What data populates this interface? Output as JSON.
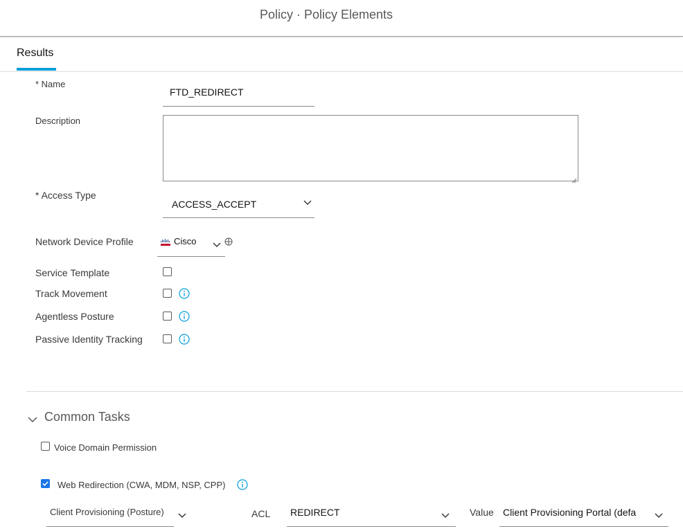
{
  "header": {
    "title": "Policy · Policy Elements"
  },
  "tabs": [
    {
      "label": "Results",
      "active": true
    }
  ],
  "form": {
    "name": {
      "label": "* Name",
      "value": "FTD_REDIRECT"
    },
    "description": {
      "label": "Description",
      "value": ""
    },
    "access_type": {
      "label": "* Access Type",
      "value": "ACCESS_ACCEPT"
    },
    "network_device_profile": {
      "label": "Network Device Profile",
      "value": "Cisco"
    },
    "service_template": {
      "label": "Service Template",
      "checked": false
    },
    "track_movement": {
      "label": "Track Movement",
      "checked": false
    },
    "agentless_posture": {
      "label": "Agentless Posture",
      "checked": false
    },
    "passive_identity_tracking": {
      "label": "Passive Identity Tracking",
      "checked": false
    }
  },
  "common_tasks": {
    "title": "Common Tasks",
    "voice_domain_permission": {
      "label": "Voice Domain Permission",
      "checked": false
    },
    "web_redirection": {
      "label": "Web Redirection (CWA, MDM, NSP, CPP)",
      "checked": true,
      "type_value": "Client Provisioning (Posture)",
      "acl_label": "ACL",
      "acl_value": "REDIRECT",
      "value_label": "Value",
      "value_value": "Client Provisioning Portal (defa"
    }
  },
  "colors": {
    "accent": "#049fd9",
    "info": "#049fd9",
    "checkbox_checked": "#1c75e8"
  },
  "icons": [
    "chevron-down-icon",
    "info-icon",
    "globe-icon",
    "cisco-logo-icon",
    "resize-handle-icon"
  ]
}
